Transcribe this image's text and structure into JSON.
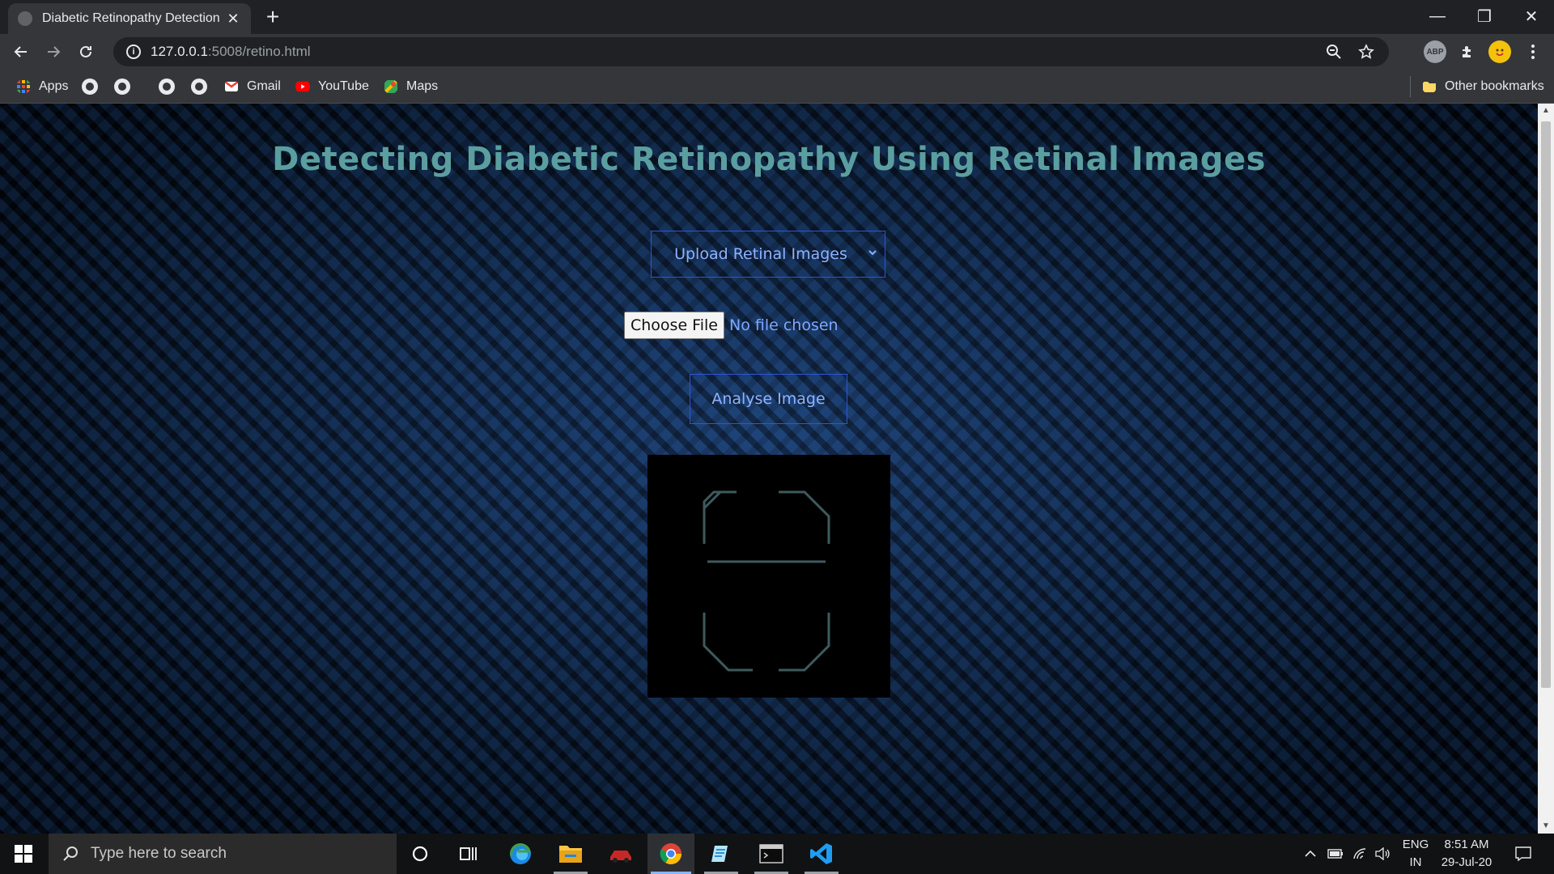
{
  "browser": {
    "tab_title": "Diabetic Retinopathy Detection",
    "tab_close": "✕",
    "new_tab": "+",
    "url_host": "127.0.0.1",
    "url_path": ":5008/retino.html",
    "window_controls": {
      "minimize": "—",
      "restore": "❐",
      "close": "✕"
    },
    "extensions": {
      "abp": "ABP"
    }
  },
  "bookmarks": {
    "apps_label": "Apps",
    "gmail_label": "Gmail",
    "youtube_label": "YouTube",
    "maps_label": "Maps",
    "other_label": "Other bookmarks"
  },
  "page": {
    "title": "Detecting Diabetic Retinopathy Using Retinal Images",
    "upload_dropdown_label": "Upload Retinal Images",
    "choose_file_label": "Choose File",
    "file_status": "No file chosen",
    "analyse_button_label": "Analyse Image"
  },
  "taskbar": {
    "search_placeholder": "Type here to search",
    "language": "ENG",
    "region": "IN",
    "time": "8:51 AM",
    "date": "29-Jul-20"
  },
  "colors": {
    "title": "#5b9ea0",
    "button_border": "#2f56d6",
    "button_text": "#8fb2ff",
    "chrome_dark": "#202124",
    "chrome_toolbar": "#35363a"
  }
}
